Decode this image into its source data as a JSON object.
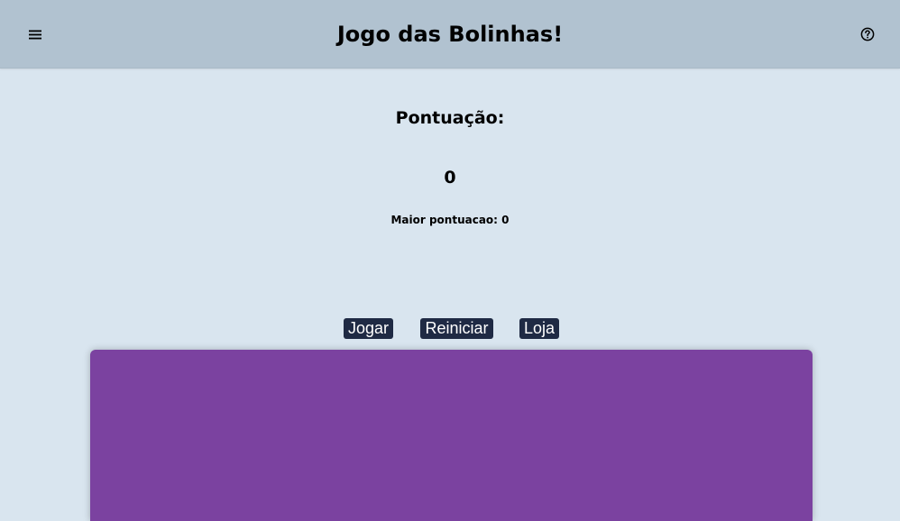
{
  "header": {
    "title": "Jogo das Bolinhas!",
    "menu_icon": "hamburger-menu-icon",
    "help_icon": "help-circle-icon"
  },
  "score": {
    "label": "Pontuação:",
    "value": "0",
    "high_score_label": "Maior pontuacao:",
    "high_score_value": "0"
  },
  "controls": {
    "play_label": "Jogar",
    "restart_label": "Reiniciar",
    "shop_label": "Loja"
  },
  "colors": {
    "header_bg": "#b1c2d0",
    "page_bg": "#d9e5ef",
    "button_bg": "#1f2a44",
    "game_area_bg": "#7b42a0"
  }
}
